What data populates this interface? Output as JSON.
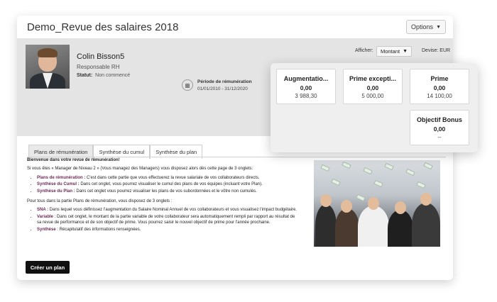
{
  "header": {
    "title": "Demo_Revue des salaires 2018",
    "options_label": "Options"
  },
  "employee": {
    "name": "Colin Bisson5",
    "role": "Responsable RH",
    "status_label": "Statut:",
    "status_value": "Non commencé"
  },
  "period": {
    "label": "Période de rémunération",
    "value": "01/01/2010 - 31/12/2020"
  },
  "display": {
    "label": "Afficher:",
    "selected": "Montant",
    "currency": "Devise: EUR"
  },
  "kpis": [
    {
      "title": "Augmentatio...",
      "value": "0,00",
      "sub": "3 988,30"
    },
    {
      "title": "Prime excepti...",
      "value": "0,00",
      "sub": "5 000,00"
    },
    {
      "title": "Prime",
      "value": "0,00",
      "sub": "14 100,00"
    },
    {
      "title": "Objectif Bonus",
      "value": "0,00",
      "sub": "--"
    }
  ],
  "tabs": [
    "Plans de rémunération",
    "Synthèse du cumul",
    "Synthèse du plan"
  ],
  "content": {
    "welcome": "Bienvenue dans votre revue de rémunération!",
    "intro": "Si vous êtes « Manager de Niveau 2 » (Vous managez des Managers) vous disposez alors dès cette page de 3 onglets:",
    "list1": [
      {
        "term": "Plans de rémunération :",
        "text": " C'est dans cette partie que vous effectuerez la revue salariale de vos collaborateurs directs."
      },
      {
        "term": "Synthèse du Cumul :",
        "text": " Dans cet onglet, vous pourrez visualiser le cumul des plans de vos équipes (incluant votre Plan)."
      },
      {
        "term": "Synthèse du Plan :",
        "text": " Dans cet onglet vous pourrez visualiser les plans de vos subordonnées et le vôtre non cumulés."
      }
    ],
    "intro2": "Pour tous dans la partie Plans de rémunération, vous disposez de 3 onglets :",
    "list2": [
      {
        "term": "SNA :",
        "text": " Dans lequel vous définissez l'augmentation du Salaire Nominal Annuel de vos collaborateurs et vous visualisez l'impact budgétaire."
      },
      {
        "term": "Variable",
        "text": " : Dans cet onglet, le montant de la partie variable de votre collaborateur sera automatiquement rempli par rapport au résultat de sa revue de performance et de son objectif de prime. Vous pourrez saisir le nouvel objectif de prime pour l'année prochaine."
      },
      {
        "term": "Synthèse",
        "text": " : Récapitulatif des informations renseignées."
      }
    ]
  },
  "actions": {
    "create_plan": "Créer un plan"
  },
  "colors": {
    "accent_term": "#6c2b57",
    "band": "#e4e4e4",
    "button_dark": "#111111"
  }
}
